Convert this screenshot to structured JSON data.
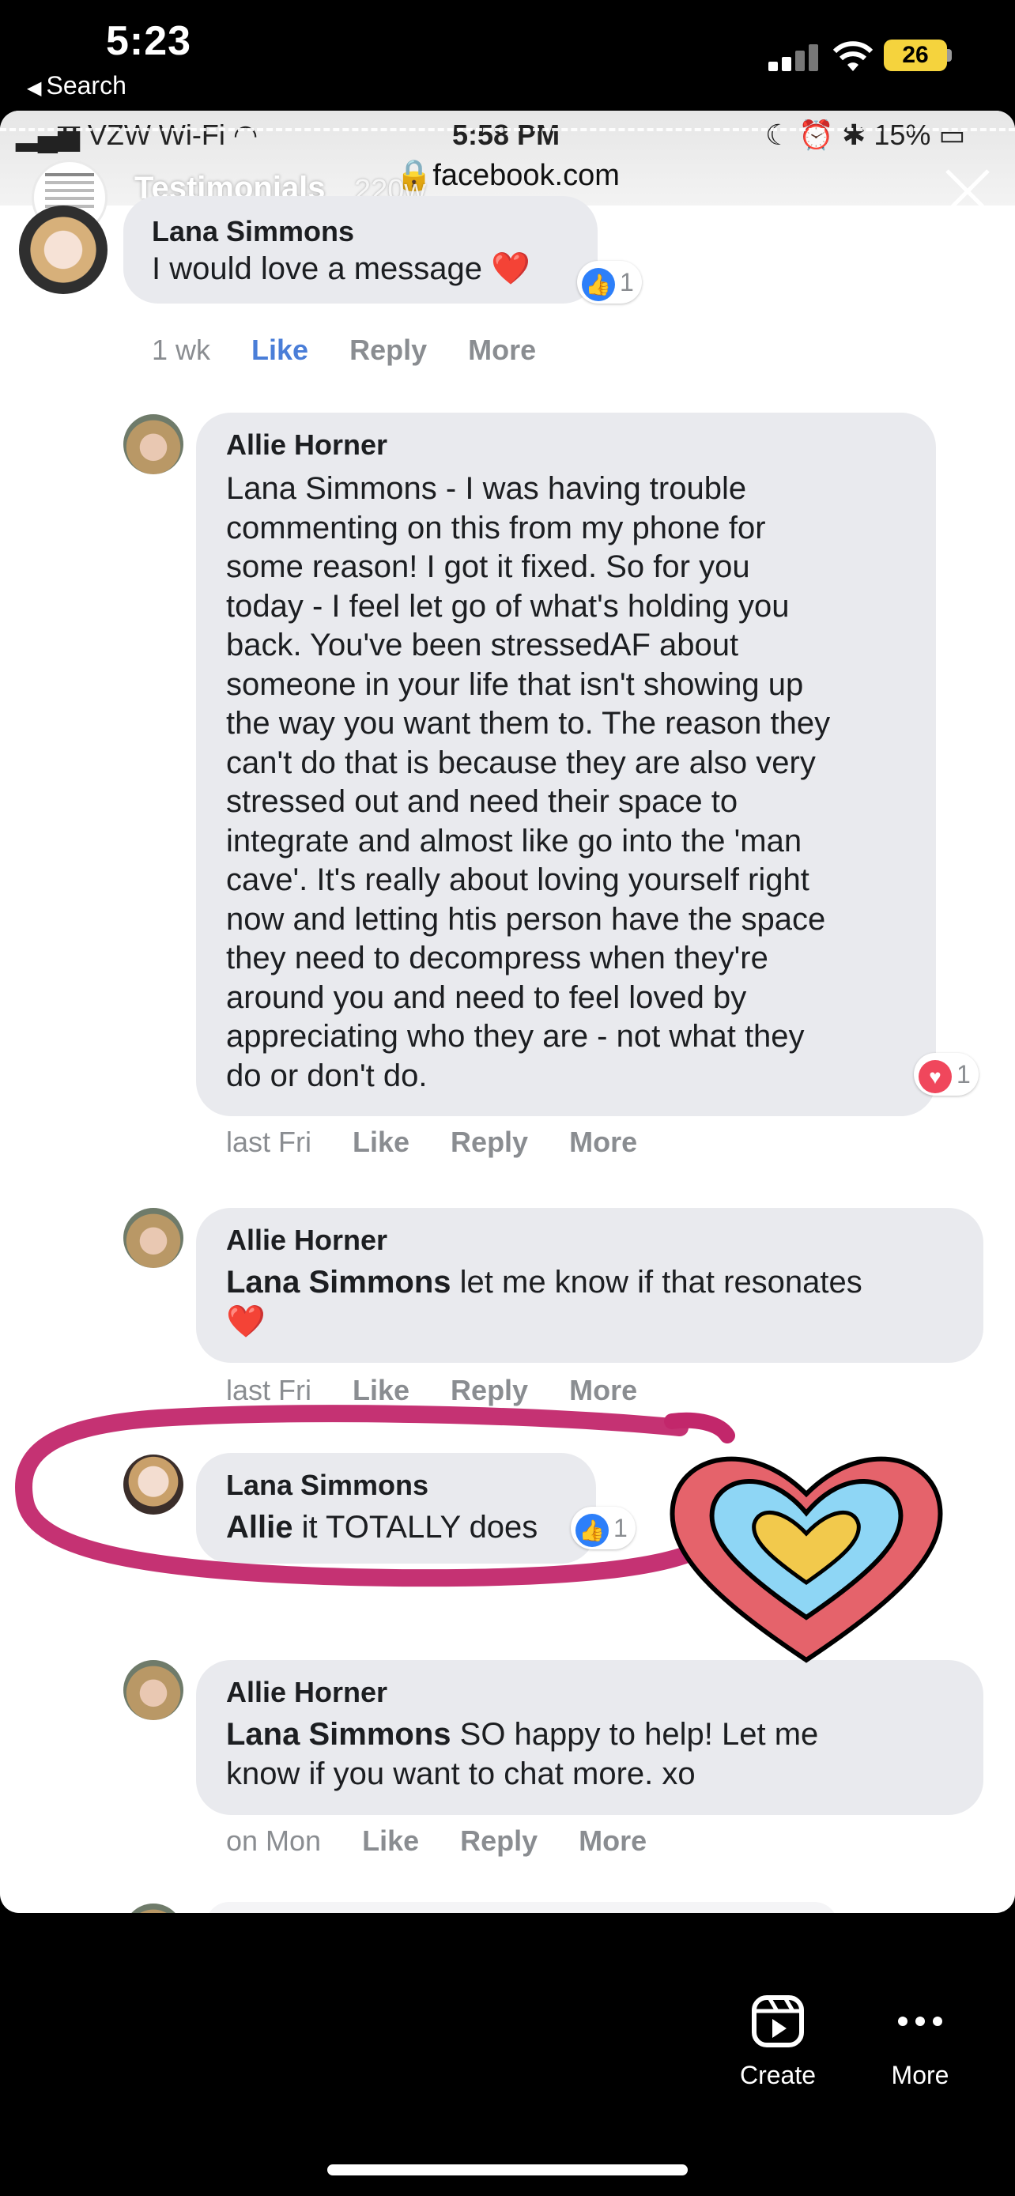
{
  "ig_status": {
    "time": "5:23",
    "back_label": "Search",
    "battery": "26"
  },
  "inner_status": {
    "carrier": "VZW Wi-Fi",
    "time": "5:58 PM",
    "battery": "15%",
    "url": "facebook.com"
  },
  "story": {
    "title": "Testimonials",
    "age": "220w"
  },
  "comments": [
    {
      "name": "Lana Simmons",
      "text": "I would love a message ❤️",
      "reaction_count": "1",
      "meta": {
        "time": "1 wk",
        "like": "Like",
        "reply": "Reply",
        "more": "More"
      }
    },
    {
      "name": "Allie Horner",
      "lines": [
        "Lana Simmons - I was having trouble",
        "commenting on this from my phone for",
        "some reason! I got it fixed. So for you",
        "today - I feel let go of what's holding you",
        "back. You've been stressedAF about",
        "someone in your life that isn't showing up",
        "the way you want them to. The reason they",
        "can't do that is because they are also very",
        "stressed out and need their space to",
        "integrate and almost like go into the 'man",
        "cave'. It's really about loving yourself right",
        "now and letting htis person have the space",
        "they need to decompress when they're",
        "around you and need to feel loved by",
        "appreciating who they are - not what they",
        "do or don't do."
      ],
      "reaction_count": "1",
      "meta": {
        "time": "last Fri",
        "like": "Like",
        "reply": "Reply",
        "more": "More"
      }
    },
    {
      "name": "Allie Horner",
      "mention": "Lana Simmons",
      "text": "let me know if that resonates",
      "emoji": "❤️",
      "meta": {
        "time": "last Fri",
        "like": "Like",
        "reply": "Reply",
        "more": "More"
      }
    },
    {
      "name": "Lana Simmons",
      "mention": "Allie",
      "text": "it TOTALLY does",
      "reaction_count": "1"
    },
    {
      "name": "Allie Horner",
      "mention": "Lana Simmons",
      "text": "SO happy to help! Let me",
      "text2": "know if you want to chat more. xo",
      "meta": {
        "time": "on Mon",
        "like": "Like",
        "reply": "Reply",
        "more": "More"
      }
    }
  ],
  "bottom_bar": {
    "create": "Create",
    "more": "More"
  },
  "colors": {
    "like_blue": "#2d7ff9",
    "love_red": "#f0475c",
    "highlight_pink": "#c2276b"
  }
}
